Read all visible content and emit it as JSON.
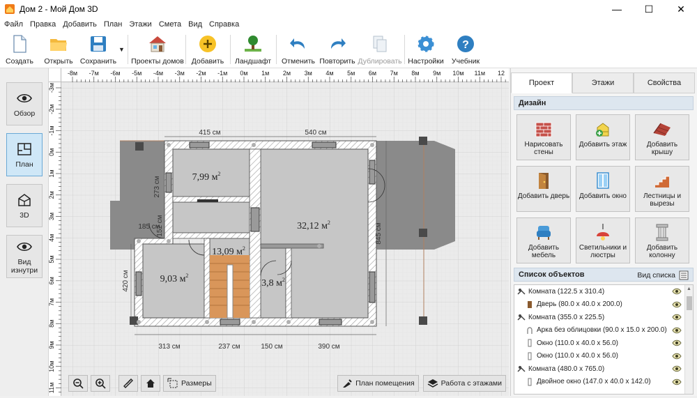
{
  "window": {
    "title": "Дом 2 - Мой Дом 3D",
    "controls": [
      "—",
      "☐",
      "✕"
    ]
  },
  "menu": [
    "Файл",
    "Правка",
    "Добавить",
    "План",
    "Этажи",
    "Смета",
    "Вид",
    "Справка"
  ],
  "toolbar": {
    "create": "Создать",
    "open": "Открыть",
    "save": "Сохранить",
    "projects": "Проекты домов",
    "add": "Добавить",
    "landscape": "Ландшафт",
    "undo": "Отменить",
    "redo": "Повторить",
    "duplicate": "Дублировать",
    "settings": "Настройки",
    "tutorial": "Учебник"
  },
  "view_buttons": {
    "overview": "Обзор",
    "plan": "План",
    "three_d": "3D",
    "inside": "Вид изнутри"
  },
  "ruler": {
    "top": [
      "-8м",
      "-7м",
      "-6м",
      "-5м",
      "-4м",
      "-3м",
      "-2м",
      "-1м",
      "0м",
      "1м",
      "2м",
      "3м",
      "4м",
      "5м",
      "6м",
      "7м",
      "8м",
      "9м",
      "10м",
      "11м",
      "12"
    ],
    "left": [
      "-3м",
      "-2м",
      "-1м",
      "0м",
      "1м",
      "2м",
      "3м",
      "4м",
      "5м",
      "6м",
      "7м",
      "8м",
      "9м",
      "10м",
      "11м"
    ]
  },
  "plan": {
    "dims": {
      "top_left": "415 см",
      "top_right": "540 см",
      "left_upper": "273 см",
      "left_small": "152 см",
      "left_lower": "420 см",
      "right_side": "845 см",
      "inner": "185 см",
      "bottom_1": "313 см",
      "bottom_2": "237 см",
      "bottom_3": "150 см",
      "bottom_4": "390 см"
    },
    "rooms": {
      "r1": "7,99 м",
      "r2": "32,12 м",
      "r3": "13,09 м",
      "r4": "9,03 м",
      "r5": "3,8 м"
    },
    "sup": "2"
  },
  "canvas_tools": {
    "dimensions": "Размеры",
    "room_plan": "План помещения",
    "floors_work": "Работа с этажами"
  },
  "right_panel": {
    "tabs": [
      "Проект",
      "Этажи",
      "Свойства"
    ],
    "design_title": "Дизайн",
    "design_buttons": [
      {
        "label": "Нарисовать стены",
        "icon": "brick-wall-icon"
      },
      {
        "label": "Добавить этаж",
        "icon": "add-floor-icon"
      },
      {
        "label": "Добавить крышу",
        "icon": "roof-icon"
      },
      {
        "label": "Добавить дверь",
        "icon": "door-icon"
      },
      {
        "label": "Добавить окно",
        "icon": "window-icon"
      },
      {
        "label": "Лестницы и вырезы",
        "icon": "stairs-icon"
      },
      {
        "label": "Добавить мебель",
        "icon": "armchair-icon"
      },
      {
        "label": "Светильники и люстры",
        "icon": "lamp-icon"
      },
      {
        "label": "Добавить колонну",
        "icon": "column-icon"
      }
    ],
    "objects_title": "Список объектов",
    "list_view": "Вид списка",
    "objects": [
      {
        "text": "Комната  (122.5 x 310.4)",
        "indent": 0,
        "icon": "room"
      },
      {
        "text": "Дверь  (80.0 x 40.0 x 200.0)",
        "indent": 1,
        "icon": "door"
      },
      {
        "text": "Комната  (355.0 x 225.5)",
        "indent": 0,
        "icon": "room"
      },
      {
        "text": "Арка без облицовки  (90.0 x 15.0 x 200.0)",
        "indent": 1,
        "icon": "arch"
      },
      {
        "text": "Окно  (110.0 x 40.0 x 56.0)",
        "indent": 1,
        "icon": "window"
      },
      {
        "text": "Окно  (110.0 x 40.0 x 56.0)",
        "indent": 1,
        "icon": "window"
      },
      {
        "text": "Комната  (480.0 x 765.0)",
        "indent": 0,
        "icon": "room"
      },
      {
        "text": "Двойное окно  (147.0 x 40.0 x 142.0)",
        "indent": 1,
        "icon": "window"
      }
    ]
  },
  "colors": {
    "accent": "#2f7fc1",
    "floor_fill": "#c6c6c6",
    "wall": "#ffffff",
    "terrace": "#8c8c8c",
    "stairs": "#d9965a"
  }
}
